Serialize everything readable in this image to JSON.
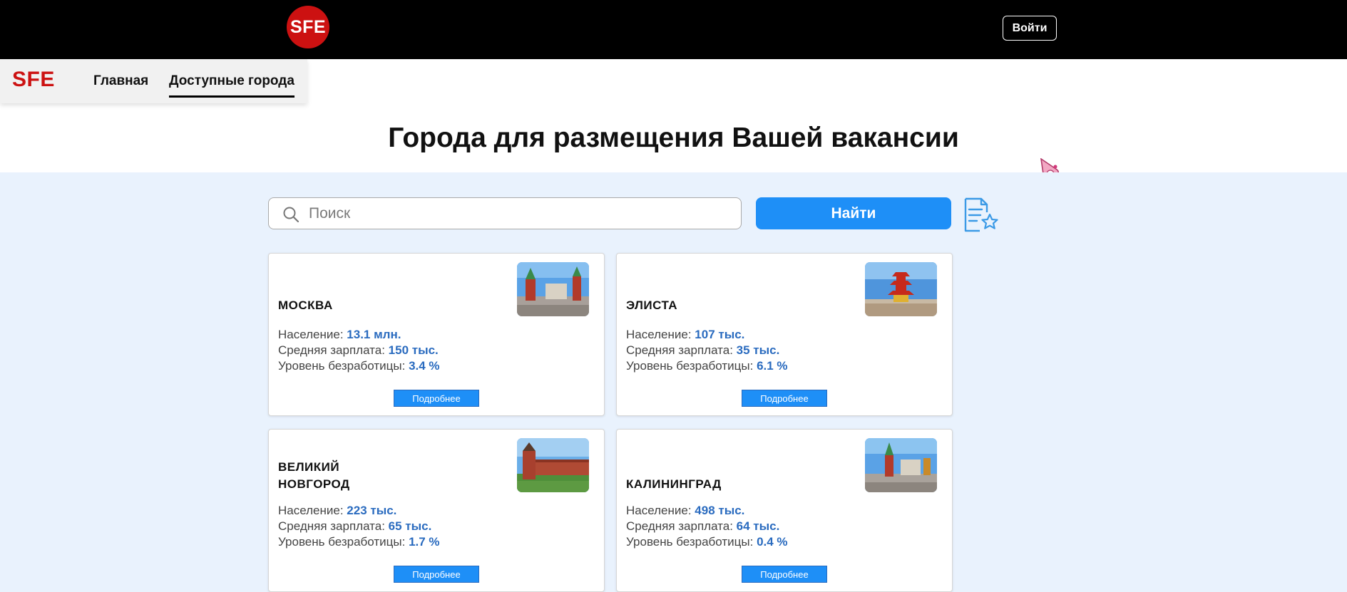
{
  "header": {
    "logo_text": "SFE",
    "login_label": "Войти"
  },
  "nav": {
    "logo_text": "SFE",
    "items": [
      {
        "label": "Главная",
        "active": false
      },
      {
        "label": "Доступные города",
        "active": true
      }
    ]
  },
  "page": {
    "title": "Города для размещения Вашей вакансии"
  },
  "search": {
    "placeholder": "Поиск",
    "value": "",
    "button_label": "Найти"
  },
  "icons": {
    "search": "search-icon",
    "favorites": "document-star-icon",
    "extension": "extension-icon"
  },
  "colors": {
    "brand_red": "#cc1111",
    "accent_blue": "#1e8ff7",
    "value_blue": "#2a6bbf",
    "content_bg": "#e9f2fd"
  },
  "cities": [
    {
      "name": "МОСКВА",
      "population_label": "Население:",
      "population": "13.1 млн.",
      "salary_label": "Средняя зарплата:",
      "salary": "150 тыс.",
      "unemployment_label": "Уровень безработицы:",
      "unemployment": "3.4 %",
      "button_label": "Подробнее"
    },
    {
      "name": "ЭЛИСТА",
      "population_label": "Население:",
      "population": "107 тыс.",
      "salary_label": "Средняя зарплата:",
      "salary": "35 тыс.",
      "unemployment_label": "Уровень безработицы:",
      "unemployment": "6.1 %",
      "button_label": "Подробнее"
    },
    {
      "name_line1": "ВЕЛИКИЙ",
      "name_line2": "НОВГОРОД",
      "population_label": "Население:",
      "population": "223 тыс.",
      "salary_label": "Средняя зарплата:",
      "salary": "65 тыс.",
      "unemployment_label": "Уровень безработицы:",
      "unemployment": "1.7 %",
      "button_label": "Подробнее"
    },
    {
      "name": "КАЛИНИНГРАД",
      "population_label": "Население:",
      "population": "498 тыс.",
      "salary_label": "Средняя зарплата:",
      "salary": "64 тыс.",
      "unemployment_label": "Уровень безработицы:",
      "unemployment": "0.4 %",
      "button_label": "Подробнее"
    }
  ]
}
